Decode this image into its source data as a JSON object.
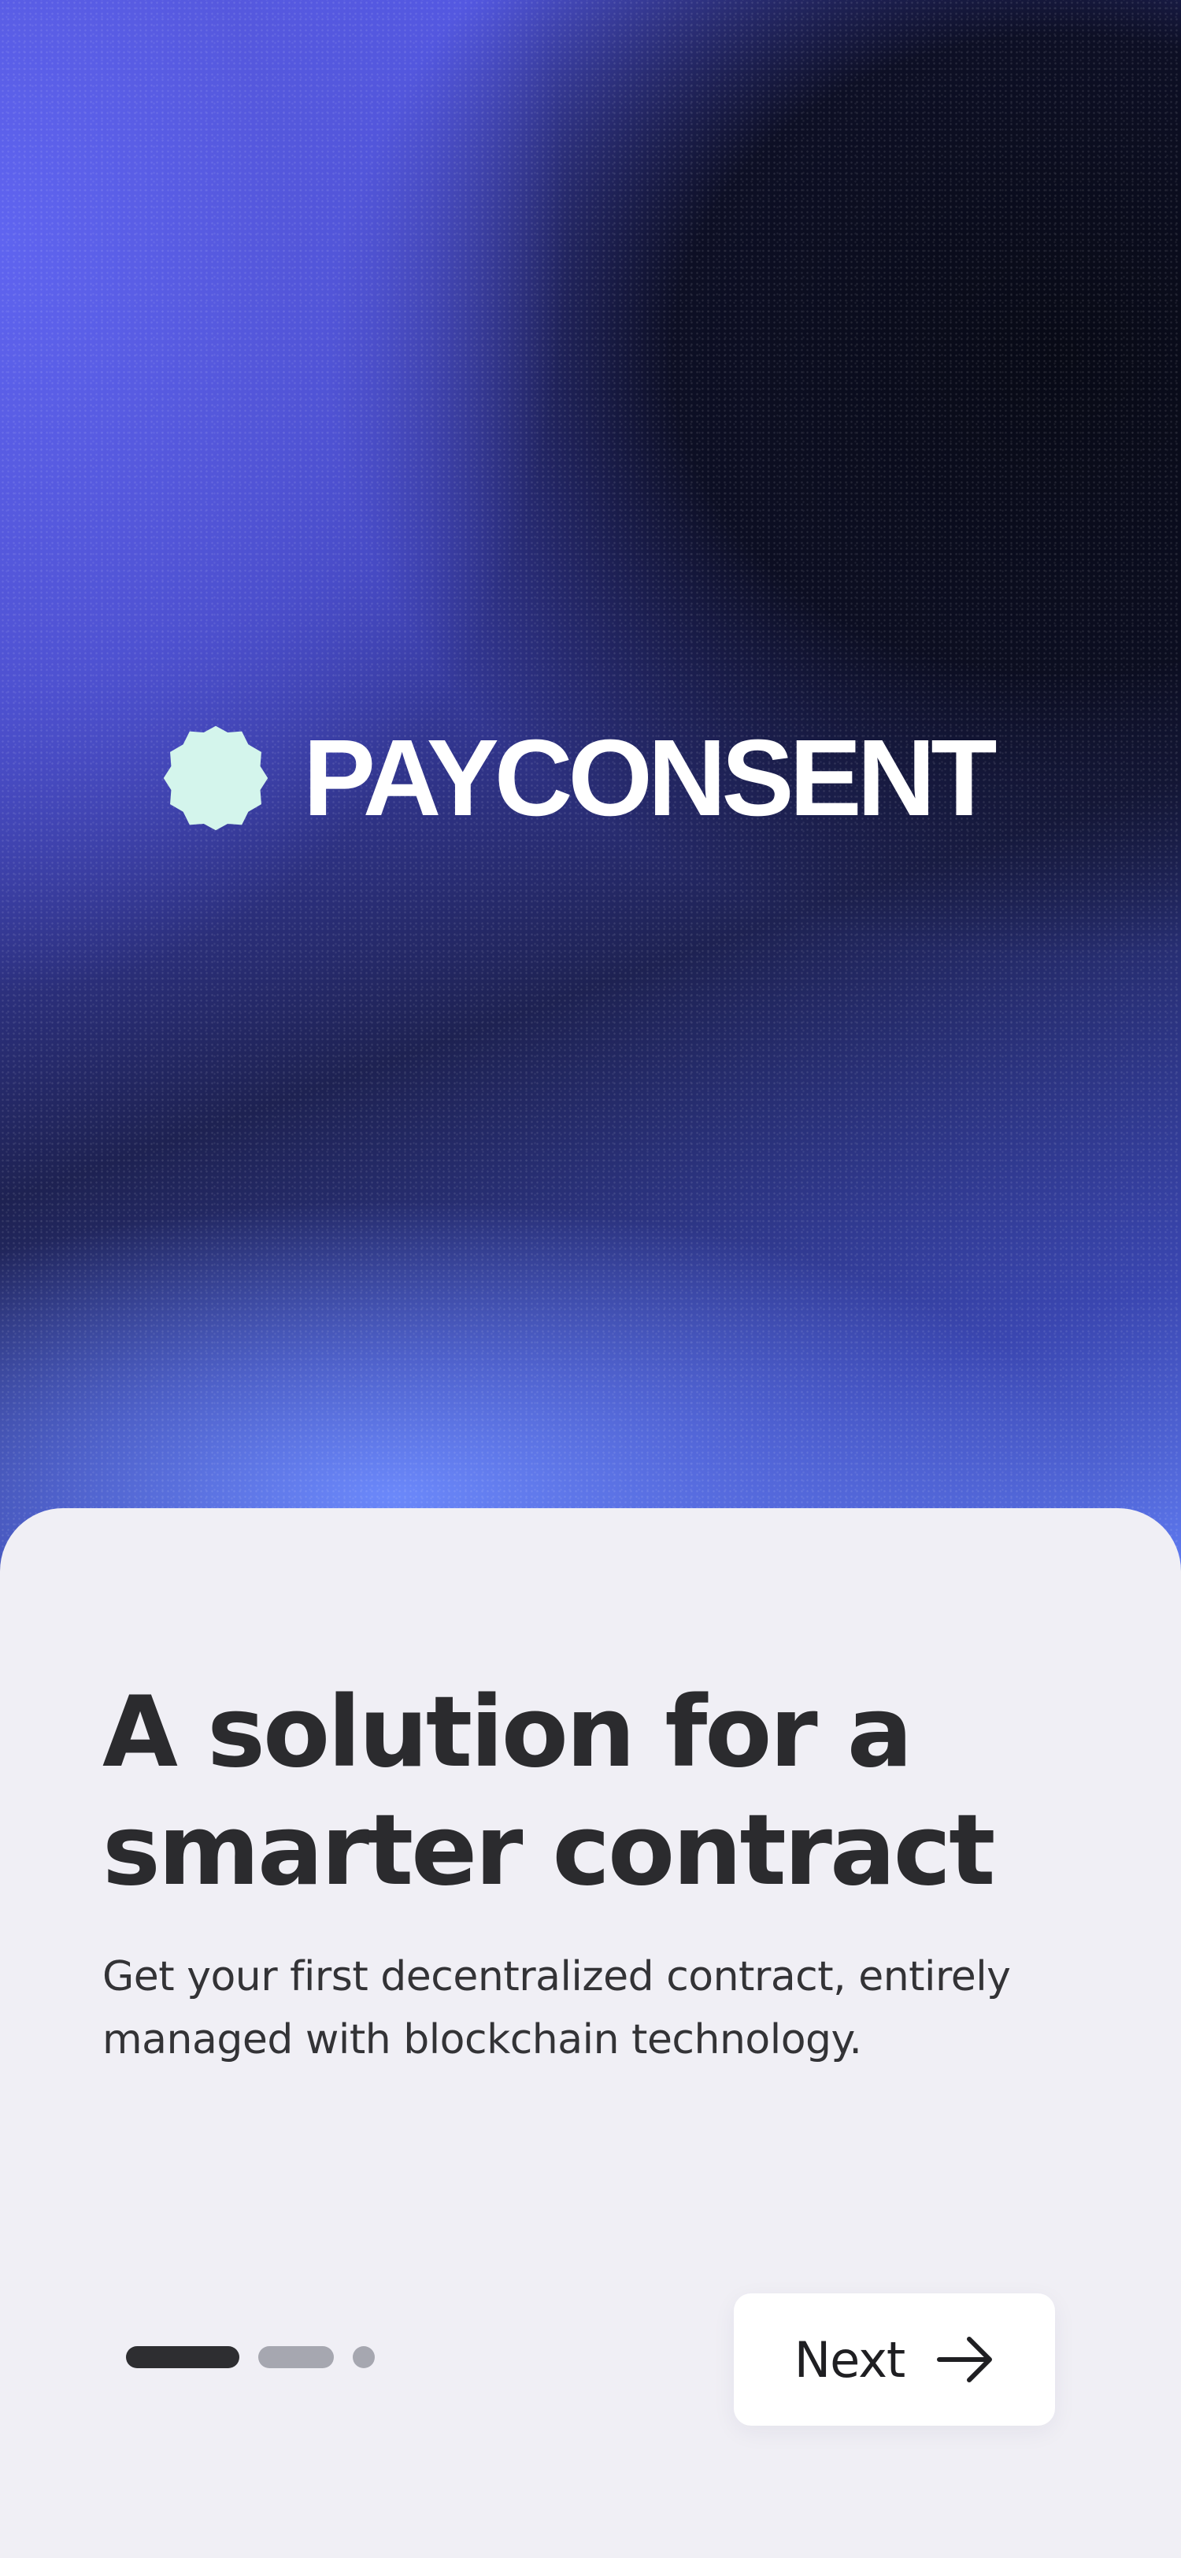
{
  "brand": {
    "name": "PAYCONSENT",
    "logo_icon": "badge-seal-icon",
    "logo_color": "#d4f5ec"
  },
  "onboarding": {
    "headline_line1": "A solution for a",
    "headline_line2": "smarter contract",
    "subtitle_line1": "Get your first decentralized contract, entirely",
    "subtitle_line2": "managed with blockchain technology.",
    "pager": {
      "total": 3,
      "current": 1
    },
    "next_button": {
      "label": "Next",
      "icon": "arrow-right-icon"
    }
  },
  "colors": {
    "sheet_background": "#f0eff5",
    "headline": "#2b2b2e",
    "pager_active": "#2e2e31",
    "pager_inactive": "#a6a7b0",
    "gradient_blue": "#5a5ff0",
    "gradient_dark": "#0b0c17"
  }
}
